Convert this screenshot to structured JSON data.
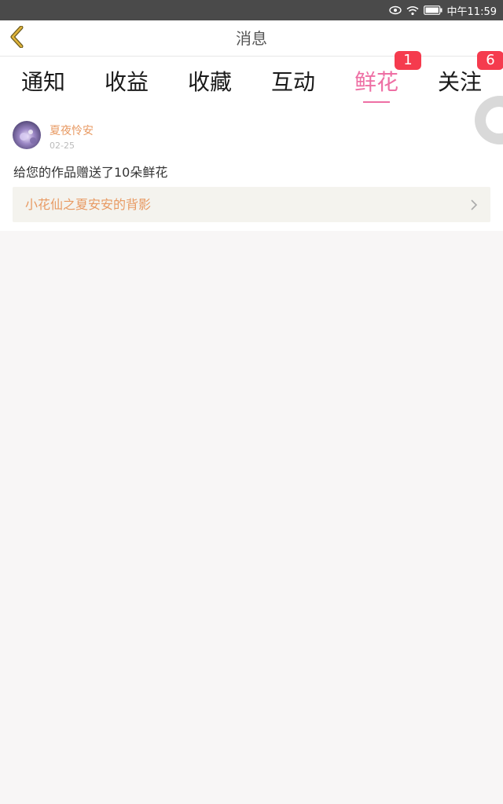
{
  "status_bar": {
    "time": "中午11:59",
    "icons": [
      "eye-icon",
      "wifi-icon",
      "battery-icon"
    ]
  },
  "header": {
    "title": "消息",
    "back_icon": "chevron-left-icon",
    "accent_color": "#e0b43a"
  },
  "tabs": [
    {
      "label": "通知",
      "badge": ""
    },
    {
      "label": "收益",
      "badge": ""
    },
    {
      "label": "收藏",
      "badge": ""
    },
    {
      "label": "互动",
      "badge": ""
    },
    {
      "label": "鲜花",
      "badge": "1",
      "active": true
    },
    {
      "label": "关注",
      "badge": "6"
    }
  ],
  "colors": {
    "active_tab": "#ee6fa4",
    "badge": "#f53b4e",
    "username": "#e89a63"
  },
  "notification": {
    "username": "夏夜怜安",
    "date": "02-25",
    "message": "给您的作品赠送了10朵鲜花",
    "work_title": "小花仙之夏安安的背影"
  }
}
